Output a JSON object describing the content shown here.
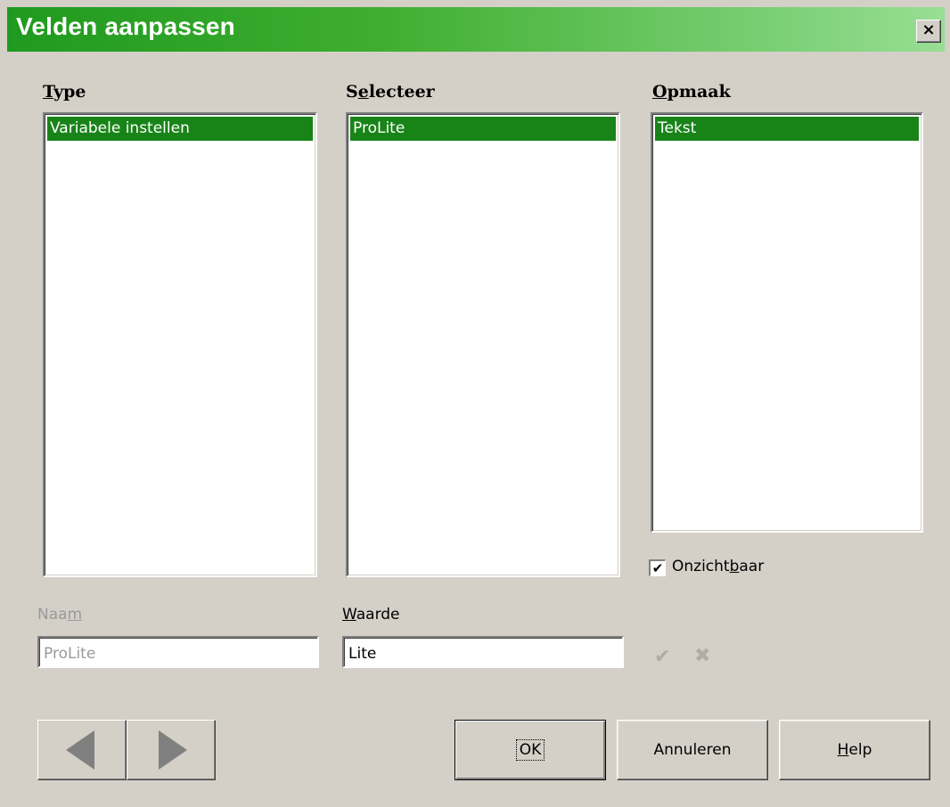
{
  "window": {
    "title": "Velden aanpassen",
    "close_symbol": "×"
  },
  "columns": {
    "type": {
      "label": "Type",
      "items": [
        "Variabele instellen"
      ],
      "selected_index": 0
    },
    "select": {
      "label": "Selecteer",
      "items": [
        "ProLite"
      ],
      "selected_index": 0
    },
    "format": {
      "label": "Opmaak",
      "items": [
        "Tekst"
      ],
      "selected_index": 0
    }
  },
  "invisible_checkbox": {
    "label": "Onzichtbaar",
    "checked": true
  },
  "name_field": {
    "label": "Naam",
    "value": "ProLite",
    "disabled": true
  },
  "value_field": {
    "label": "Waarde",
    "value": "Lite"
  },
  "icons": {
    "apply": "check-icon",
    "delete": "delete-icon"
  },
  "buttons": {
    "ok": "OK",
    "cancel": "Annuleren",
    "help": "Help"
  },
  "colors": {
    "selection": "#188418",
    "title_start": "#1f9a1f",
    "title_end": "#98de94",
    "dialog_bg": "#d4d0c8"
  }
}
